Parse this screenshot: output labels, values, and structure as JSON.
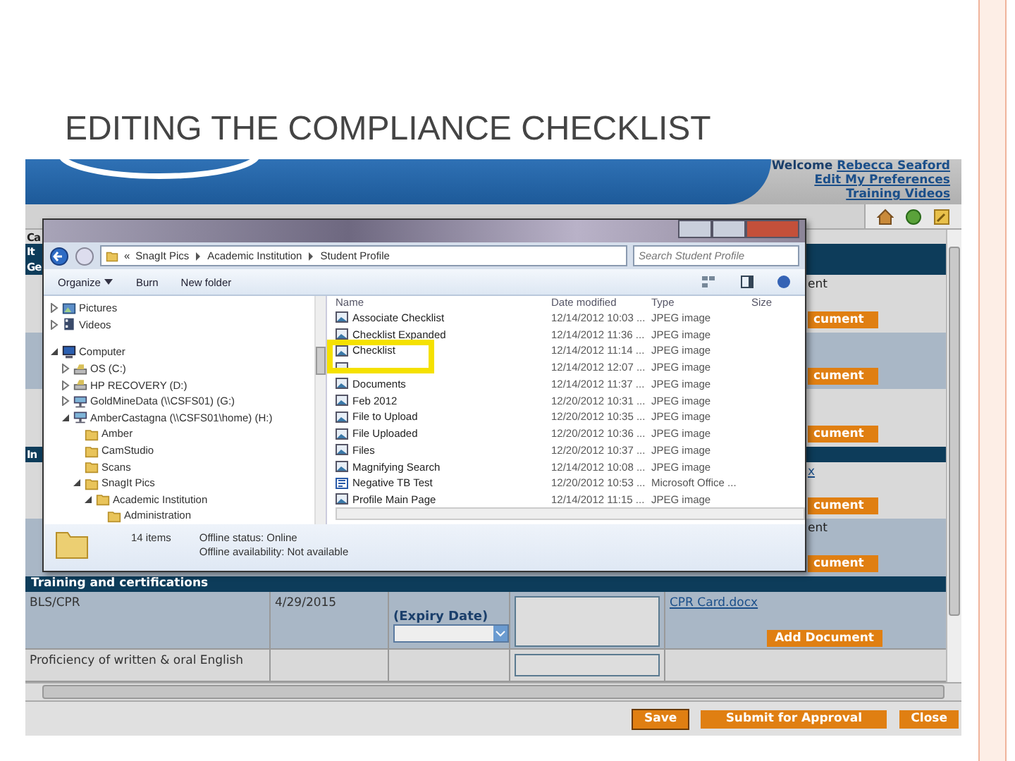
{
  "slide": {
    "title": "EDITING THE COMPLIANCE CHECKLIST"
  },
  "app": {
    "welcome_label": "Welcome",
    "user_link": "Rebecca Seaford",
    "links": [
      "Edit My Preferences",
      "Training Videos"
    ],
    "rows": [
      {
        "kind": "plain",
        "left": "Ca"
      },
      {
        "kind": "section",
        "left": "It"
      },
      {
        "kind": "section",
        "left": "Ge"
      },
      {
        "kind": "plain",
        "right_text": "ent",
        "right_button": "cument"
      },
      {
        "kind": "alt",
        "right_button": "cument"
      },
      {
        "kind": "plain",
        "right_button": "cument"
      },
      {
        "kind": "section",
        "left": "In"
      },
      {
        "kind": "plain",
        "right_link": "x",
        "right_button": "cument"
      },
      {
        "kind": "alt",
        "right_text": "ent",
        "right_button": "cument"
      }
    ],
    "training": {
      "header": "Training and certifications",
      "rows": [
        {
          "kind": "alt",
          "name": "BLS/CPR",
          "date": "4/29/2015",
          "expiry_label": "(Expiry Date)",
          "file_link": "CPR Card.docx",
          "button": "Add Document"
        },
        {
          "kind": "plain",
          "name": "Proficiency of written & oral English"
        }
      ]
    },
    "footer_buttons": [
      {
        "label": "Save",
        "focused": true
      },
      {
        "label": "Submit for Approval",
        "focused": false
      },
      {
        "label": "Close",
        "focused": false
      }
    ]
  },
  "explorer": {
    "overflow": "«",
    "breadcrumb": [
      "SnagIt Pics",
      "Academic Institution",
      "Student Profile"
    ],
    "search_placeholder": "Search Student Profile",
    "toolbar": [
      {
        "label": "Organize",
        "menu": true
      },
      {
        "label": "Burn",
        "menu": false
      },
      {
        "label": "New folder",
        "menu": false
      }
    ],
    "tree": [
      {
        "label": "Pictures",
        "kind": "pictures",
        "expanded": false
      },
      {
        "label": "Videos",
        "kind": "videos",
        "expanded": false
      },
      {
        "label": "Computer",
        "kind": "computer",
        "expanded": true,
        "children": [
          {
            "label": "OS (C:)",
            "kind": "drive",
            "expanded": false
          },
          {
            "label": "HP RECOVERY (D:)",
            "kind": "drive",
            "expanded": false
          },
          {
            "label": "GoldMineData (\\\\CSFS01) (G:)",
            "kind": "network",
            "expanded": false
          },
          {
            "label": "AmberCastagna (\\\\CSFS01\\home) (H:)",
            "kind": "network",
            "expanded": true,
            "children": [
              {
                "label": "Amber",
                "kind": "folder"
              },
              {
                "label": "CamStudio",
                "kind": "folder"
              },
              {
                "label": "Scans",
                "kind": "folder"
              },
              {
                "label": "SnagIt Pics",
                "kind": "folder",
                "expanded": true,
                "children": [
                  {
                    "label": "Academic Institution",
                    "kind": "folder",
                    "expanded": true,
                    "children": [
                      {
                        "label": "Administration",
                        "kind": "folder"
                      }
                    ]
                  }
                ]
              }
            ]
          }
        ]
      }
    ],
    "columns": [
      "Name",
      "Date modified",
      "Type",
      "Size"
    ],
    "files": [
      {
        "name": "Associate Checklist",
        "date": "12/14/2012 10:03 ...",
        "type": "JPEG image",
        "kind": "image",
        "highlighted": false
      },
      {
        "name": "Checklist Expanded",
        "date": "12/14/2012 11:36 ...",
        "type": "JPEG image",
        "kind": "image",
        "highlighted": false
      },
      {
        "name": "Checklist",
        "date": "12/14/2012 11:14 ...",
        "type": "JPEG image",
        "kind": "image",
        "highlighted": true
      },
      {
        "date": "12/14/2012 12:07 ...",
        "type": "JPEG image",
        "kind": "image",
        "highlighted": false
      },
      {
        "name": "Documents",
        "date": "12/14/2012 11:37 ...",
        "type": "JPEG image",
        "kind": "image",
        "highlighted": false
      },
      {
        "name": "Feb 2012",
        "date": "12/20/2012 10:31 ...",
        "type": "JPEG image",
        "kind": "image",
        "highlighted": false
      },
      {
        "name": "File to Upload",
        "date": "12/20/2012 10:35 ...",
        "type": "JPEG image",
        "kind": "image",
        "highlighted": false
      },
      {
        "name": "File Uploaded",
        "date": "12/20/2012 10:36 ...",
        "type": "JPEG image",
        "kind": "image",
        "highlighted": false
      },
      {
        "name": "Files",
        "date": "12/20/2012 10:37 ...",
        "type": "JPEG image",
        "kind": "image",
        "highlighted": false
      },
      {
        "name": "Magnifying Search",
        "date": "12/14/2012 10:08 ...",
        "type": "JPEG image",
        "kind": "image",
        "highlighted": false
      },
      {
        "name": "Negative TB Test",
        "date": "12/20/2012 10:53 ...",
        "type": "Microsoft Office ...",
        "kind": "document",
        "highlighted": false
      },
      {
        "name": "Profile Main Page",
        "date": "12/14/2012 11:15 ...",
        "type": "JPEG image",
        "kind": "image",
        "highlighted": false
      }
    ],
    "status": {
      "count": "14 items",
      "offline_label": "Offline status:",
      "offline_value": "Online",
      "availability_label": "Offline availability:",
      "availability_value": "Not available"
    }
  }
}
